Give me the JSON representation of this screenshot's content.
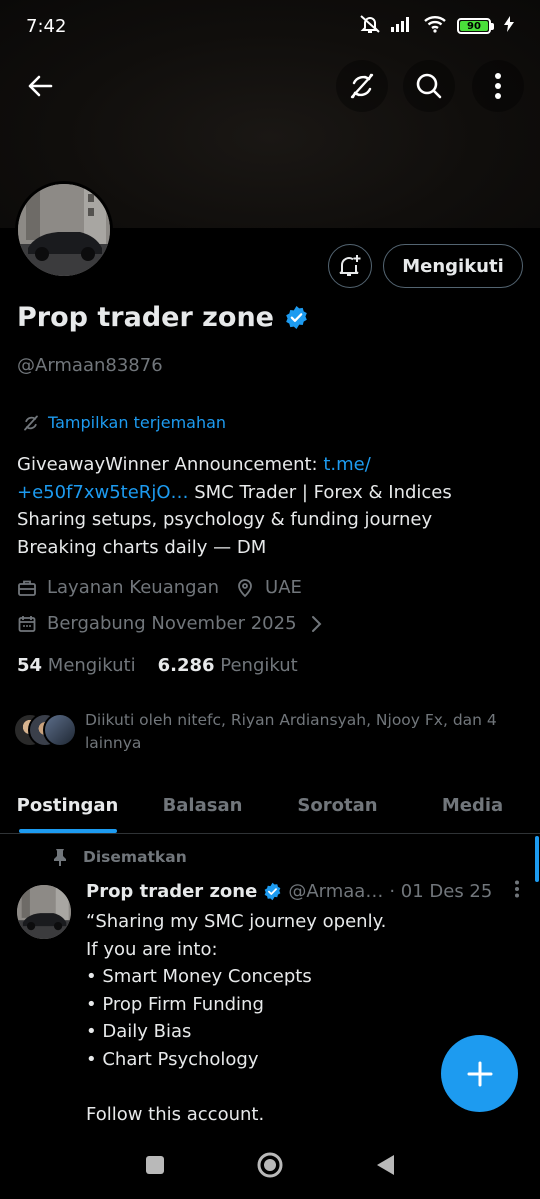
{
  "status_bar": {
    "time": "7:42",
    "battery": "90"
  },
  "profile": {
    "name": "Prop trader zone",
    "handle": "@Armaan83876",
    "follow_button": "Mengikuti",
    "translate_link": "Tampilkan terjemahan",
    "bio_text_1": "GiveawayWinner Announcement: ",
    "bio_link_1": "t.me/",
    "bio_link_2": "+e50f7xw5teRjO…",
    "bio_text_2": " SMC Trader | Forex & Indices",
    "bio_line_3": "Sharing setups, psychology & funding journey",
    "bio_line_4": "Breaking charts daily — DM",
    "category": "Layanan Keuangan",
    "location": "UAE",
    "joined": "Bergabung November 2025",
    "following_count": "54",
    "following_label": "Mengikuti",
    "followers_count": "6.286",
    "followers_label": "Pengikut",
    "followed_by": "Diikuti oleh nitefc, Riyan Ardiansyah, Njooy Fx, dan 4 lainnya"
  },
  "tabs": [
    {
      "label": "Postingan"
    },
    {
      "label": "Balasan"
    },
    {
      "label": "Sorotan"
    },
    {
      "label": "Media"
    }
  ],
  "post": {
    "pinned_label": "Disematkan",
    "author": "Prop trader zone",
    "handle": "@Armaa…",
    "date": "· 01 Des 25",
    "lines": [
      "“Sharing my SMC journey openly.",
      "If you are into:",
      "• Smart Money Concepts",
      "• Prop Firm Funding",
      "• Daily Bias",
      "• Chart Psychology",
      "",
      "Follow this account."
    ]
  },
  "colors": {
    "accent": "#1d9bf0",
    "muted": "#71767b",
    "text": "#e7e9ea",
    "border": "#2f3336"
  }
}
